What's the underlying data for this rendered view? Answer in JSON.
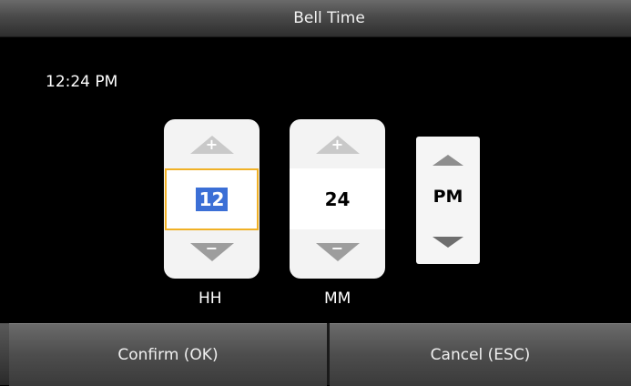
{
  "window": {
    "title": "Bell Time"
  },
  "time_readout": "12:24 PM",
  "hour": {
    "value": "12",
    "label": "HH",
    "increment_icon": "plus-icon",
    "decrement_icon": "minus-icon"
  },
  "minute": {
    "value": "24",
    "label": "MM",
    "increment_icon": "plus-icon",
    "decrement_icon": "minus-icon"
  },
  "period": {
    "value": "PM",
    "up_icon": "triangle-up-icon",
    "down_icon": "triangle-down-icon"
  },
  "buttons": {
    "confirm": "Confirm (OK)",
    "cancel": "Cancel (ESC)"
  },
  "colors": {
    "focus_border": "#f0b126",
    "selection": "#3b6fd6",
    "background": "#000000"
  }
}
